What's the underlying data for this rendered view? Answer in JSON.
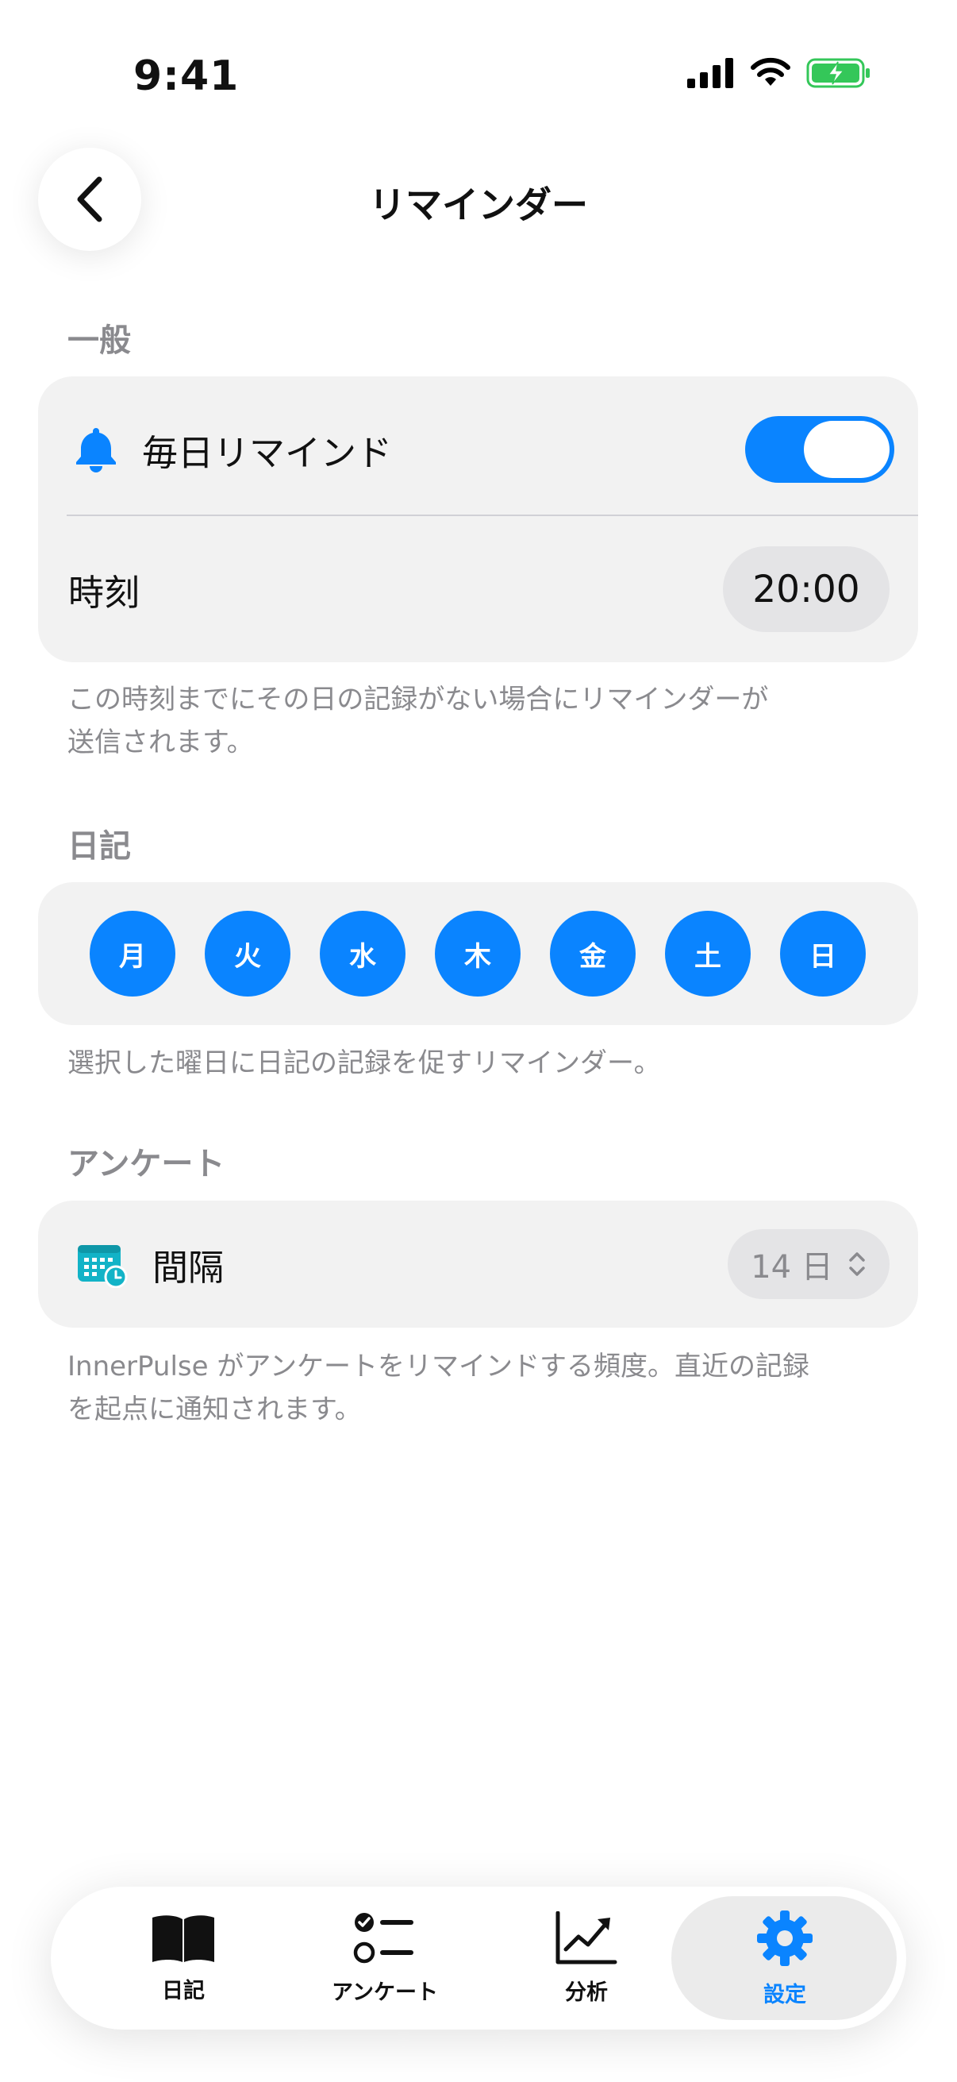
{
  "status_bar": {
    "time": "9:41"
  },
  "header": {
    "title": "リマインダー",
    "back_icon": "chevron-left-icon"
  },
  "general": {
    "section_label": "一般",
    "daily_reminder_label": "毎日リマインド",
    "daily_reminder_icon": "bell-icon",
    "daily_reminder_on": true,
    "time_label": "時刻",
    "time_value": "20:00",
    "caption_line1": "この時刻までにその日の記録がない場合にリマインダーが",
    "caption_line2": "送信されます。"
  },
  "diary": {
    "section_label": "日記",
    "days": [
      "月",
      "火",
      "水",
      "木",
      "金",
      "土",
      "日"
    ],
    "caption": "選択した曜日に日記の記録を促すリマインダー。"
  },
  "survey": {
    "section_label": "アンケート",
    "interval_icon": "calendar-clock-icon",
    "interval_label": "間隔",
    "interval_value": "14 日",
    "caption_line1": "InnerPulse がアンケートをリマインドする頻度。直近の記録",
    "caption_line2": "を起点に通知されます。"
  },
  "tabs": [
    {
      "label": "日記",
      "icon": "book-icon"
    },
    {
      "label": "アンケート",
      "icon": "checklist-icon"
    },
    {
      "label": "分析",
      "icon": "chart-icon"
    },
    {
      "label": "設定",
      "icon": "gear-icon",
      "active": true
    }
  ],
  "colors": {
    "accent": "#0a84ff",
    "teal": "#12b3c7",
    "battery": "#34c759"
  }
}
